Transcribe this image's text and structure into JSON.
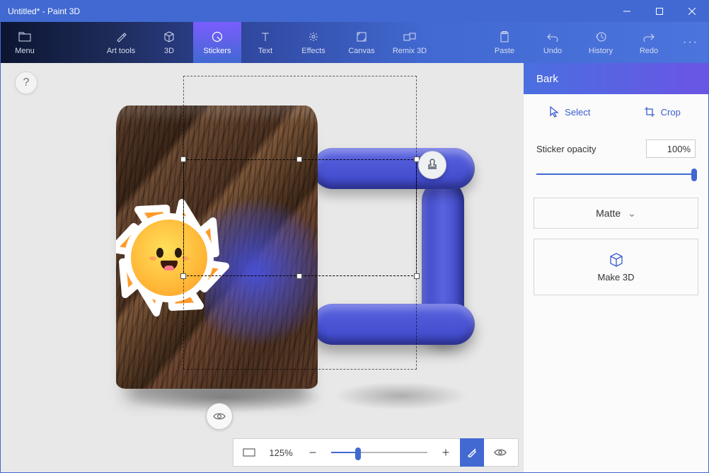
{
  "window": {
    "title": "Untitled* - Paint 3D"
  },
  "ribbon": {
    "menu": "Menu",
    "art_tools": "Art tools",
    "three_d": "3D",
    "stickers": "Stickers",
    "text": "Text",
    "effects": "Effects",
    "canvas": "Canvas",
    "remix3d": "Remix 3D",
    "paste": "Paste",
    "undo": "Undo",
    "history": "History",
    "redo": "Redo"
  },
  "help": "?",
  "zoom": {
    "value": "125%",
    "percent": 28
  },
  "panel": {
    "title": "Bark",
    "select": "Select",
    "crop": "Crop",
    "opacity_label": "Sticker opacity",
    "opacity_value": "100%",
    "material": "Matte",
    "make3d": "Make 3D"
  }
}
